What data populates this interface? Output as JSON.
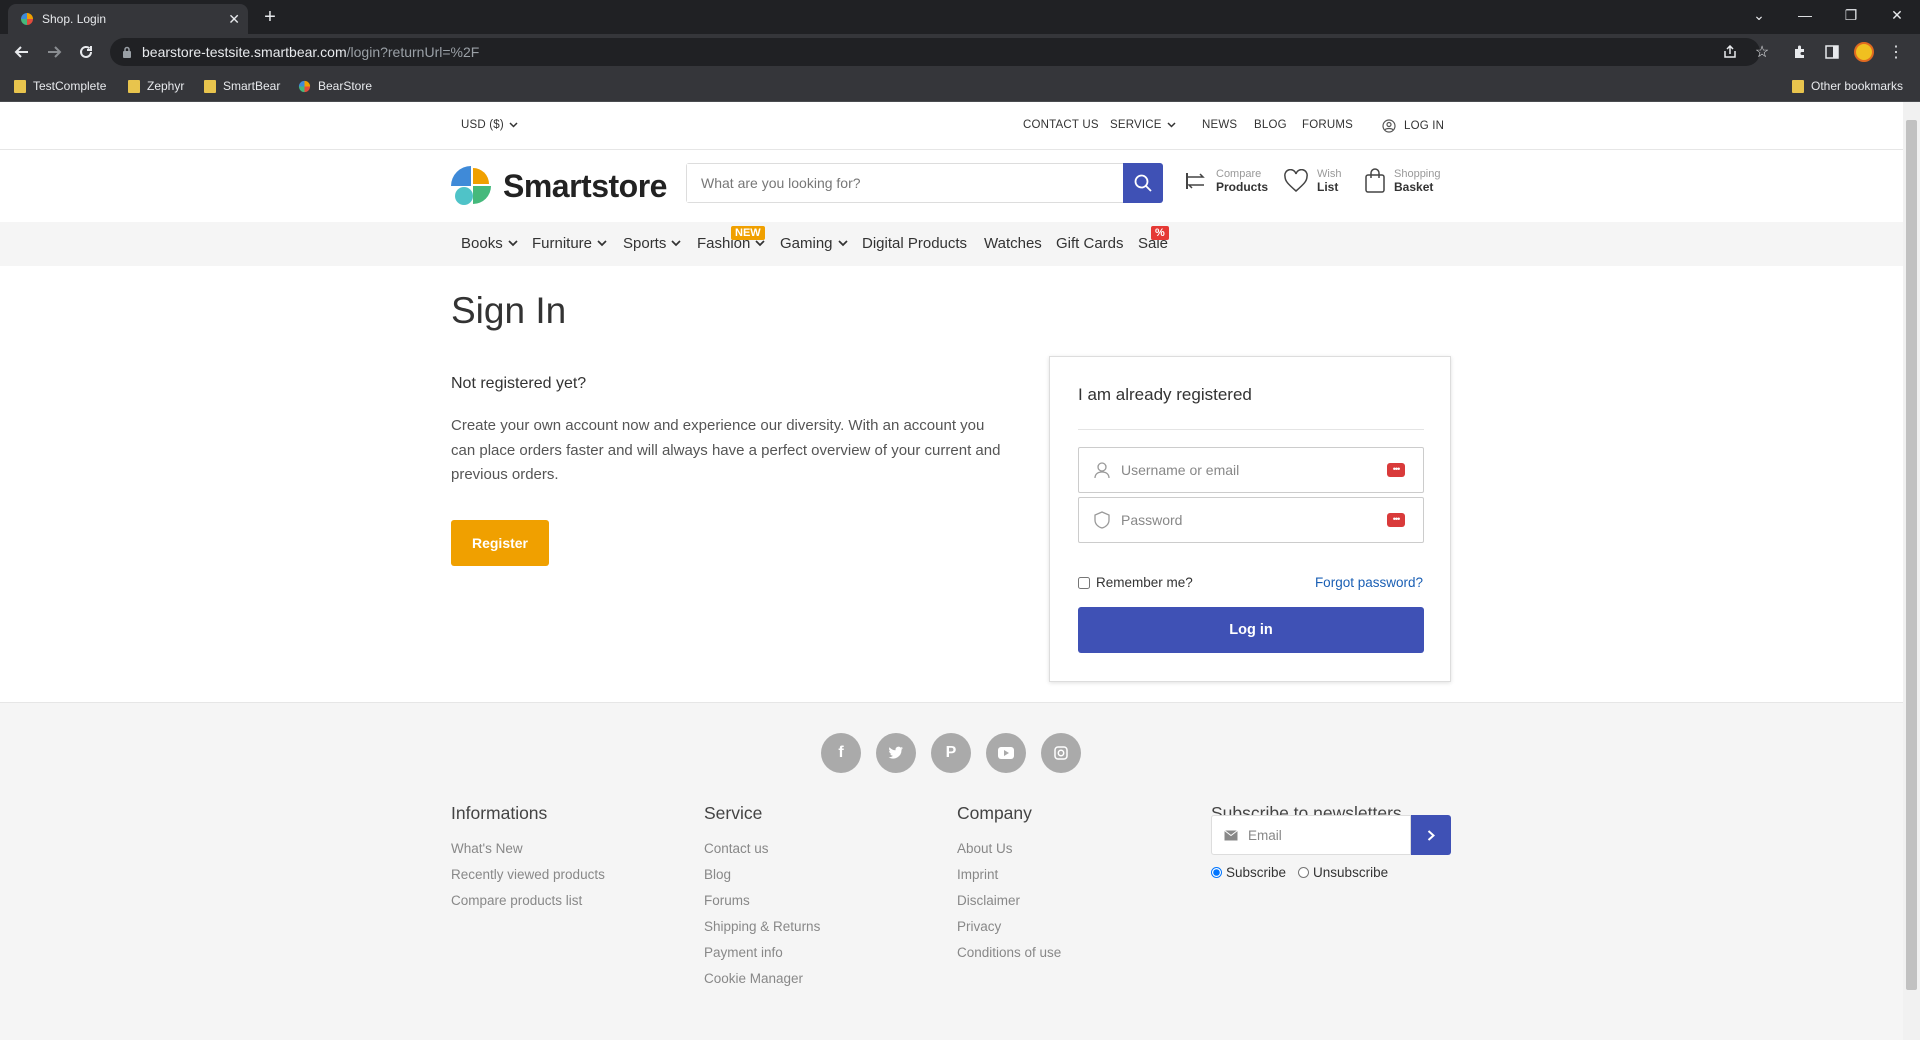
{
  "browser": {
    "tab_title": "Shop. Login",
    "url_host": "bearstore-testsite.smartbear.com",
    "url_path": "/login?returnUrl=%2F",
    "bookmarks": [
      "TestComplete",
      "Zephyr",
      "SmartBear",
      "BearStore"
    ],
    "other_bookmarks": "Other bookmarks"
  },
  "topnav": {
    "currency": "USD ($)",
    "contact": "CONTACT US",
    "service": "SERVICE",
    "news": "NEWS",
    "blog": "BLOG",
    "forums": "FORUMS",
    "login": "LOG IN"
  },
  "header": {
    "logo_text": "Smartstore",
    "search_placeholder": "What are you looking for?",
    "compare": {
      "top": "Compare",
      "bottom": "Products"
    },
    "wishlist": {
      "top": "Wish",
      "bottom": "List"
    },
    "basket": {
      "top": "Shopping",
      "bottom": "Basket"
    }
  },
  "categories": [
    {
      "label": "Books",
      "dropdown": true
    },
    {
      "label": "Furniture",
      "dropdown": true
    },
    {
      "label": "Sports",
      "dropdown": true
    },
    {
      "label": "Fashion",
      "dropdown": true,
      "badge": "NEW"
    },
    {
      "label": "Gaming",
      "dropdown": true
    },
    {
      "label": "Digital Products"
    },
    {
      "label": "Watches"
    },
    {
      "label": "Gift Cards"
    },
    {
      "label": "Sale",
      "badge": "%"
    }
  ],
  "signin": {
    "title": "Sign In",
    "not_registered": "Not registered yet?",
    "description": "Create your own account now and experience our diversity. With an account you can place orders faster and will always have a perfect overview of your current and previous orders.",
    "register_button": "Register"
  },
  "login_box": {
    "heading": "I am already registered",
    "username_placeholder": "Username or email",
    "password_placeholder": "Password",
    "remember": "Remember me?",
    "forgot": "Forgot password?",
    "login_button": "Log in"
  },
  "footer": {
    "informations": {
      "title": "Informations",
      "links": [
        "What's New",
        "Recently viewed products",
        "Compare products list"
      ]
    },
    "service": {
      "title": "Service",
      "links": [
        "Contact us",
        "Blog",
        "Forums",
        "Shipping & Returns",
        "Payment info",
        "Cookie Manager"
      ]
    },
    "company": {
      "title": "Company",
      "links": [
        "About Us",
        "Imprint",
        "Disclaimer",
        "Privacy",
        "Conditions of use"
      ]
    },
    "newsletter": {
      "title": "Subscribe to newsletters",
      "email_placeholder": "Email",
      "subscribe": "Subscribe",
      "unsubscribe": "Unsubscribe"
    }
  },
  "colors": {
    "primary": "#3f51b5",
    "register": "#f0a000",
    "new_badge": "#f0a000",
    "sale_badge": "#e53935"
  }
}
